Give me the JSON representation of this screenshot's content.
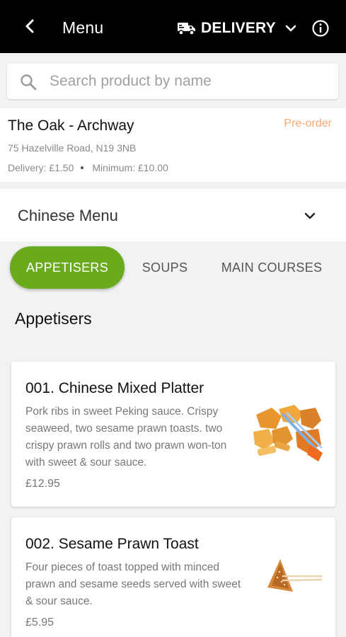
{
  "header": {
    "title": "Menu",
    "mode_label": "DELIVERY",
    "back_icon": "back-arrow-icon",
    "mode_icon": "delivery-van-icon",
    "dropdown_icon": "chevron-down-icon",
    "info_icon": "info-icon"
  },
  "search": {
    "placeholder": "Search product by name",
    "value": ""
  },
  "store": {
    "name": "The Oak - Archway",
    "status": "Pre-order",
    "address": "75 Hazelville Road, N19 3NB",
    "delivery": "Delivery: £1.50",
    "minimum": "Minimum: £10.00"
  },
  "menu_selector": {
    "selected": "Chinese Menu"
  },
  "tabs": [
    {
      "label": "APPETISERS",
      "active": true
    },
    {
      "label": "SOUPS",
      "active": false
    },
    {
      "label": "MAIN COURSES",
      "active": false
    }
  ],
  "section": {
    "title": "Appetisers"
  },
  "products": [
    {
      "title": "001. Chinese Mixed Platter",
      "description": "Pork ribs in sweet Peking sauce. Crispy seaweed, two sesame prawn toasts. two crispy prawn rolls and two prawn won-ton with sweet & sour sauce.",
      "price": "£12.95"
    },
    {
      "title": "002. Sesame Prawn Toast",
      "description": "Four pieces of toast topped with minced prawn and sesame seeds served with sweet & sour sauce.",
      "price": "£5.95"
    }
  ],
  "colors": {
    "topbar": "#000000",
    "accent": "#6aab1e",
    "preorder": "#f5a873"
  }
}
